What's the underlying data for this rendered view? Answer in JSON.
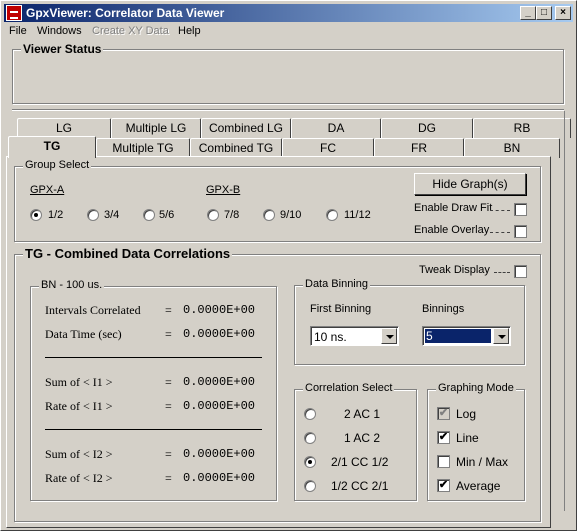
{
  "window": {
    "title": "GpxViewer: Correlator Data Viewer",
    "controls": {
      "minimize": "_",
      "maximize": "□",
      "close": "×"
    }
  },
  "menu": {
    "file": "File",
    "windows": "Windows",
    "create_xy": "Create XY Data",
    "help": "Help"
  },
  "viewer_status": {
    "label": "Viewer  Status"
  },
  "tabs": {
    "row_back": [
      "LG",
      "Multiple LG",
      "Combined LG",
      "DA",
      "DG",
      "RB"
    ],
    "row_front": [
      "TG",
      "Multiple TG",
      "Combined TG",
      "FC",
      "FR",
      "BN"
    ],
    "active": "TG"
  },
  "group_select": {
    "label": "Group Select",
    "gpx_a": "GPX-A",
    "gpx_b": "GPX-B",
    "options": [
      "1/2",
      "3/4",
      "5/6",
      "7/8",
      "9/10",
      "11/12"
    ],
    "selected": "1/2",
    "hide_graph": "Hide Graph(s)",
    "enable_draw_fit": "Enable Draw Fit",
    "enable_overlay": "Enable Overlay"
  },
  "tg_panel": {
    "title": "TG - Combined Data Correlations",
    "tweak_display": "Tweak Display",
    "bn": {
      "label": "BN - 100 us.",
      "intervals_correlated": {
        "label": "Intervals Correlated",
        "eq": "=",
        "value": "0.0000E+00"
      },
      "data_time": {
        "label": "Data Time (sec)",
        "eq": "=",
        "value": "0.0000E+00"
      },
      "sum_i1": {
        "label": "Sum  of  < I1 >",
        "eq": "=",
        "value": "0.0000E+00"
      },
      "rate_i1": {
        "label": "Rate  of  < I1 >",
        "eq": "=",
        "value": "0.0000E+00"
      },
      "sum_i2": {
        "label": "Sum  of  < I2 >",
        "eq": "=",
        "value": "0.0000E+00"
      },
      "rate_i2": {
        "label": "Rate  of  < I2 >",
        "eq": "=",
        "value": "0.0000E+00"
      }
    },
    "data_binning": {
      "label": "Data Binning",
      "first_binning_label": "First Binning",
      "first_binning_value": "10 ns.",
      "binnings_label": "Binnings",
      "binnings_value": "5"
    },
    "correlation_select": {
      "label": "Correlation Select",
      "options": [
        "2  AC  1",
        "1  AC  2",
        "2/1  CC  1/2",
        "1/2  CC  2/1"
      ],
      "selected": "2/1  CC  1/2"
    },
    "graphing_mode": {
      "label": "Graphing  Mode",
      "log": "Log",
      "line": "Line",
      "min_max": "Min / Max",
      "average": "Average",
      "check_mark": "✔"
    }
  }
}
